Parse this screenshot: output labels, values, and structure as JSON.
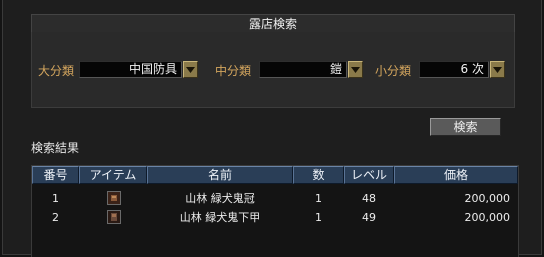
{
  "window": {
    "title": "露店検索"
  },
  "filters": {
    "major": {
      "label": "大分類",
      "value": "中国防具"
    },
    "middle": {
      "label": "中分類",
      "value": "鎧"
    },
    "minor": {
      "label": "小分類",
      "value": "6 次"
    }
  },
  "search_button": {
    "label": "検索"
  },
  "results": {
    "label": "検索結果",
    "columns": [
      "番号",
      "アイテム",
      "名前",
      "数",
      "レベル",
      "価格"
    ],
    "rows": [
      {
        "no": "1",
        "icon": "helmet-icon",
        "name": "山林 緑犬鬼冠",
        "qty": "1",
        "level": "48",
        "price": "200,000"
      },
      {
        "no": "2",
        "icon": "armor-icon",
        "name": "山林 緑犬鬼下甲",
        "qty": "1",
        "level": "49",
        "price": "200,000"
      }
    ]
  },
  "colors": {
    "label_accent": "#d4a65e",
    "header_blue": "#2a3e57",
    "dropdown_gold": "#8a7a4a"
  }
}
